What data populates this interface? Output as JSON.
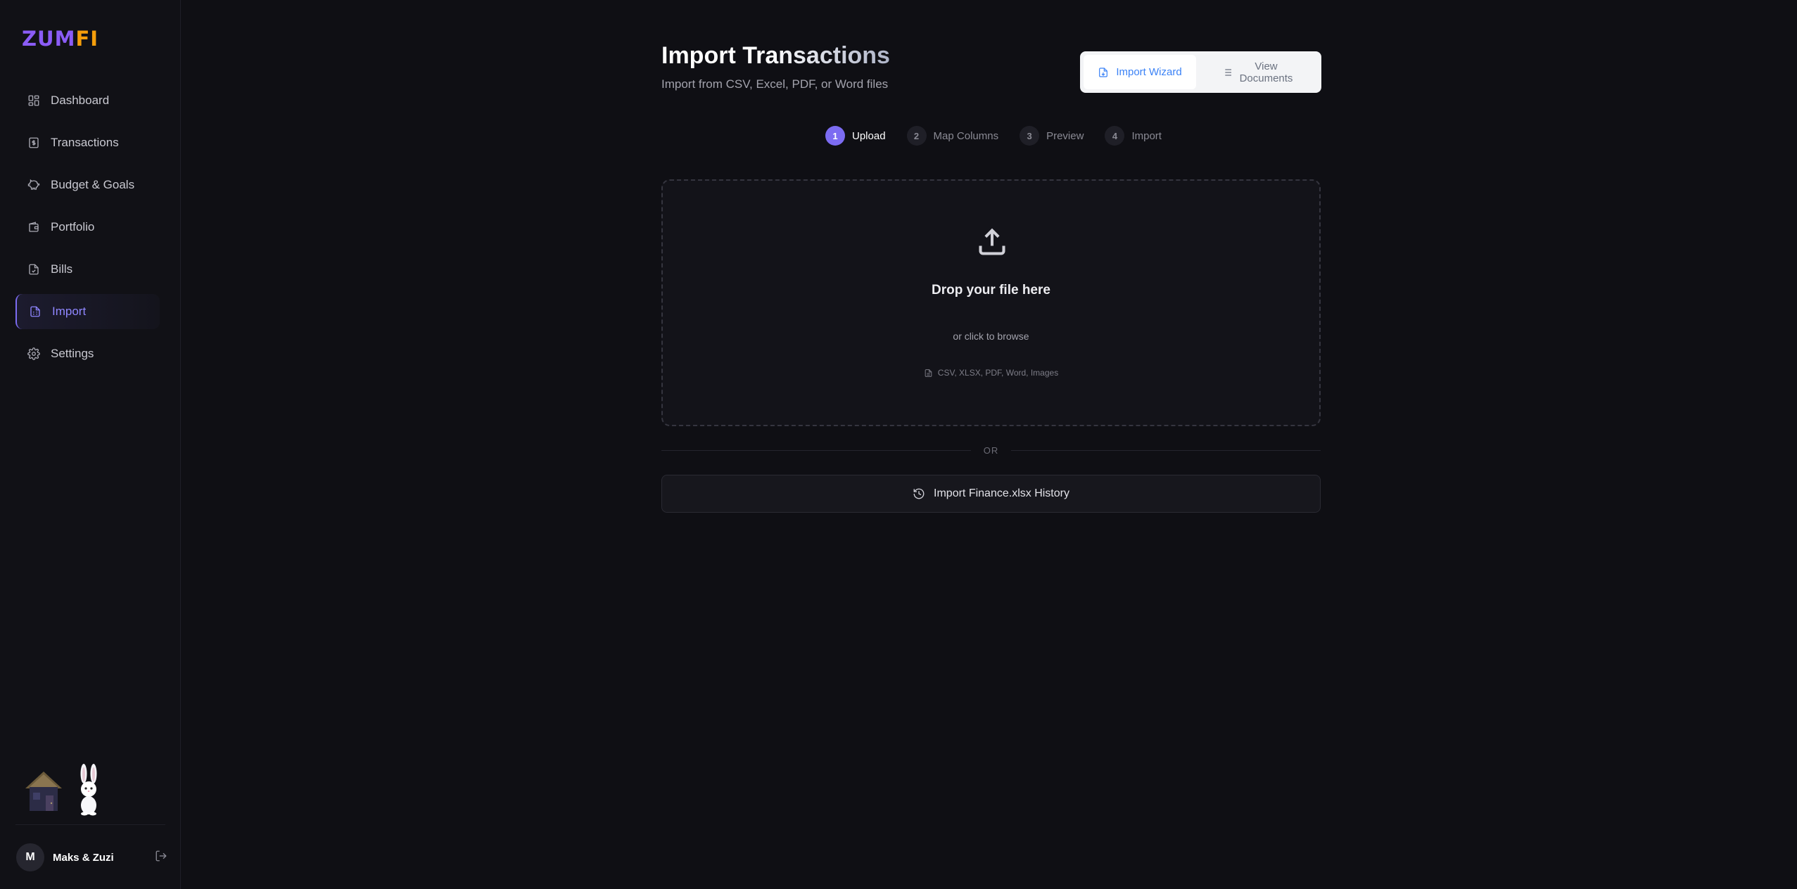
{
  "brand": {
    "logo_part1": "ZUM",
    "logo_part2": "FI"
  },
  "sidebar": {
    "items": [
      {
        "label": "Dashboard",
        "icon": "dashboard-icon"
      },
      {
        "label": "Transactions",
        "icon": "dollar-receipt-icon"
      },
      {
        "label": "Budget & Goals",
        "icon": "piggy-bank-icon"
      },
      {
        "label": "Portfolio",
        "icon": "wallet-icon"
      },
      {
        "label": "Bills",
        "icon": "bill-check-icon"
      },
      {
        "label": "Import",
        "icon": "import-file-icon",
        "active": true
      },
      {
        "label": "Settings",
        "icon": "gear-icon"
      }
    ]
  },
  "user": {
    "initial": "M",
    "name": "Maks & Zuzi"
  },
  "header": {
    "title": "Import Transactions",
    "subtitle": "Import from CSV, Excel, PDF, or Word files"
  },
  "toggle": {
    "wizard_label": "Import Wizard",
    "docs_label_line1": "View",
    "docs_label_line2": "Documents"
  },
  "steps": [
    {
      "num": "1",
      "label": "Upload",
      "active": true
    },
    {
      "num": "2",
      "label": "Map Columns"
    },
    {
      "num": "3",
      "label": "Preview"
    },
    {
      "num": "4",
      "label": "Import"
    }
  ],
  "dropzone": {
    "title": "Drop your file here",
    "subtitle": "or click to browse",
    "formats": "CSV, XLSX, PDF, Word, Images"
  },
  "divider_text": "OR",
  "history_button": "Import Finance.xlsx History",
  "colors": {
    "accent": "#7c6cf2",
    "logo_primary": "#8b5cf6",
    "logo_secondary": "#f59e0b",
    "toggle_active": "#3b82f6"
  }
}
